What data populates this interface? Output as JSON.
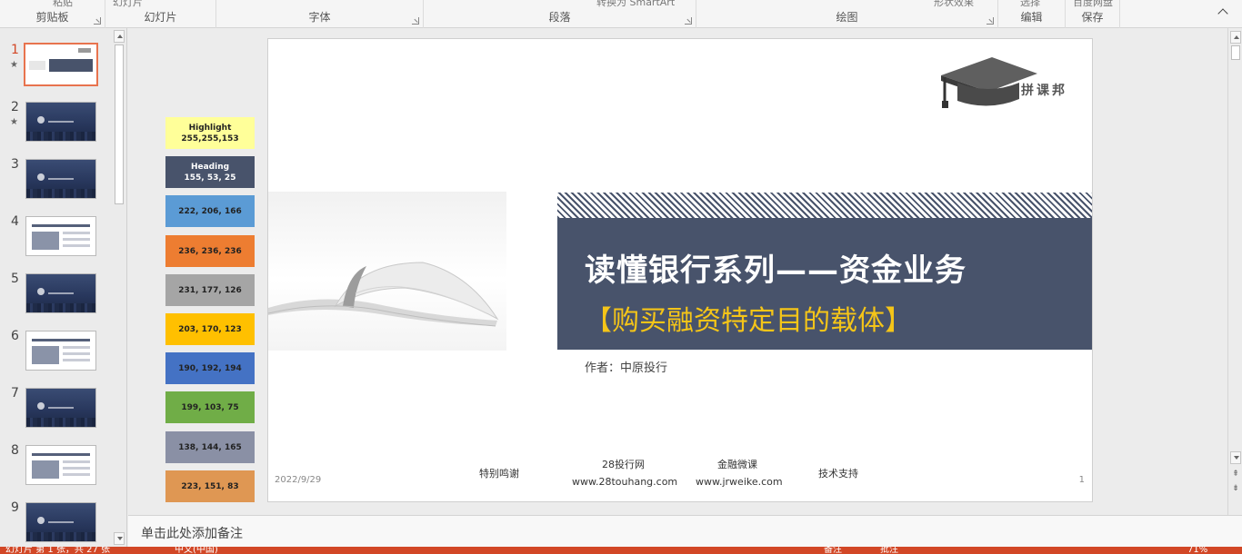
{
  "ribbon": {
    "clipped_top_labels": [
      "粘贴",
      "幻灯片",
      "转换为 SmartArt",
      "形状效果",
      "选择",
      "百度网盘"
    ],
    "groups": [
      {
        "label": "剪贴板"
      },
      {
        "label": "幻灯片"
      },
      {
        "label": "字体"
      },
      {
        "label": "段落"
      },
      {
        "label": "绘图"
      },
      {
        "label": "编辑"
      },
      {
        "label": "保存"
      }
    ]
  },
  "thumbnails": [
    {
      "number": "1",
      "star": "★",
      "style": "title",
      "active": true
    },
    {
      "number": "2",
      "star": "★",
      "style": "dark",
      "active": false
    },
    {
      "number": "3",
      "star": "",
      "style": "dark",
      "active": false
    },
    {
      "number": "4",
      "star": "",
      "style": "light",
      "active": false
    },
    {
      "number": "5",
      "star": "",
      "style": "dark",
      "active": false
    },
    {
      "number": "6",
      "star": "",
      "style": "light",
      "active": false
    },
    {
      "number": "7",
      "star": "",
      "style": "dark",
      "active": false
    },
    {
      "number": "8",
      "star": "",
      "style": "light",
      "active": false
    },
    {
      "number": "9",
      "star": "",
      "style": "dark",
      "active": false
    }
  ],
  "swatches": [
    {
      "line1": "Highlight",
      "line2": "255,255,153",
      "color": "#ffff99"
    },
    {
      "line1": "Heading",
      "line2": "155, 53, 25",
      "color": "#48536b",
      "text_color": "#ffffff"
    },
    {
      "line1": "",
      "line2": "222, 206, 166",
      "color": "#5b9bd5"
    },
    {
      "line1": "",
      "line2": "236, 236, 236",
      "color": "#ed7d31"
    },
    {
      "line1": "",
      "line2": "231, 177, 126",
      "color": "#a5a5a5"
    },
    {
      "line1": "",
      "line2": "203, 170, 123",
      "color": "#ffc000"
    },
    {
      "line1": "",
      "line2": "190, 192, 194",
      "color": "#4472c4"
    },
    {
      "line1": "",
      "line2": "199, 103, 75",
      "color": "#70ad47"
    },
    {
      "line1": "",
      "line2": "138, 144, 165",
      "color": "#8a90a5"
    },
    {
      "line1": "",
      "line2": "223, 151, 83",
      "color": "#df9753"
    }
  ],
  "slide": {
    "logo_text": "拼课邦",
    "title": "读懂银行系列——资金业务",
    "subtitle": "【购买融资特定目的载体】",
    "author": "作者：中原投行",
    "date": "2022/9/29",
    "page_number": "1",
    "credits": {
      "thanks": "特别鸣谢",
      "site1_name": "28投行网",
      "site1_url": "www.28touhang.com",
      "site2_name": "金融微课",
      "site2_url": "www.jrweike.com",
      "support": "技术支持"
    },
    "colors": {
      "band": "#48536b",
      "title": "#ffffff",
      "subtitle": "#f5c518"
    }
  },
  "notes": {
    "placeholder": "单击此处添加备注"
  },
  "status": {
    "slide_info": "幻灯片 第 1 张，共 27 张",
    "language": "中文(中国)",
    "notes_btn": "备注",
    "comments_btn": "批注",
    "zoom": "71%",
    "accent_color": "#d24726"
  }
}
